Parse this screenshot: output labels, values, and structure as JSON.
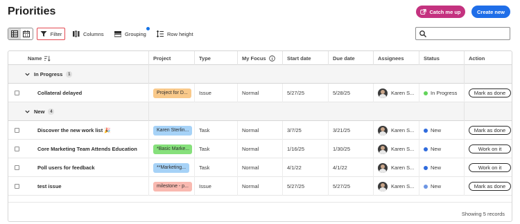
{
  "header": {
    "title": "Priorities",
    "catch_me_up": "Catch me up",
    "create_new": "Create new"
  },
  "toolbar": {
    "filter": "Filter",
    "columns": "Columns",
    "grouping": "Grouping",
    "row_height": "Row height",
    "search_placeholder": ""
  },
  "columns": [
    "Name",
    "Project",
    "Type",
    "My Focus",
    "Start date",
    "Due date",
    "Assignees",
    "Status",
    "Action"
  ],
  "groups": [
    {
      "label": "In Progress",
      "count": "1",
      "rows": [
        {
          "name": "Collateral delayed",
          "project": "Project for D...",
          "project_color": "#f9c98a",
          "type": "Issue",
          "focus": "Normal",
          "start": "5/27/25",
          "due": "5/28/25",
          "assignee": "Karen S...",
          "status": "In Progress",
          "status_color": "#63d45a",
          "action": "Mark as done"
        }
      ]
    },
    {
      "label": "New",
      "count": "4",
      "rows": [
        {
          "name": "Discover the new work list 🎉",
          "project": "Karen Sterlin...",
          "project_color": "#a6d2f7",
          "type": "Task",
          "focus": "Normal",
          "start": "3/7/25",
          "due": "3/21/25",
          "assignee": "Karen S...",
          "status": "New",
          "status_color": "#2f6bdd",
          "action": "Mark as done"
        },
        {
          "name": "Core Marketing Team Attends Education",
          "project": "*Basic Marke...",
          "project_color": "#86e07b",
          "type": "Task",
          "focus": "Normal",
          "start": "1/16/25",
          "due": "1/30/25",
          "assignee": "Karen S...",
          "status": "New",
          "status_color": "#2f6bdd",
          "action": "Work on it"
        },
        {
          "name": "Poll users for feedback",
          "project": "**Marketing...",
          "project_color": "#a6d2f7",
          "type": "Task",
          "focus": "Normal",
          "start": "4/1/22",
          "due": "4/1/22",
          "assignee": "Karen S...",
          "status": "New",
          "status_color": "#2f6bdd",
          "action": "Work on it"
        },
        {
          "name": "test issue",
          "project": "milestone - p...",
          "project_color": "#f9b9b0",
          "type": "Issue",
          "focus": "Normal",
          "start": "5/27/25",
          "due": "5/27/25",
          "assignee": "Karen S...",
          "status": "New",
          "status_color": "#6e96e4",
          "action": "Mark as done"
        }
      ]
    }
  ],
  "footer": {
    "records": "Showing 5 records"
  }
}
